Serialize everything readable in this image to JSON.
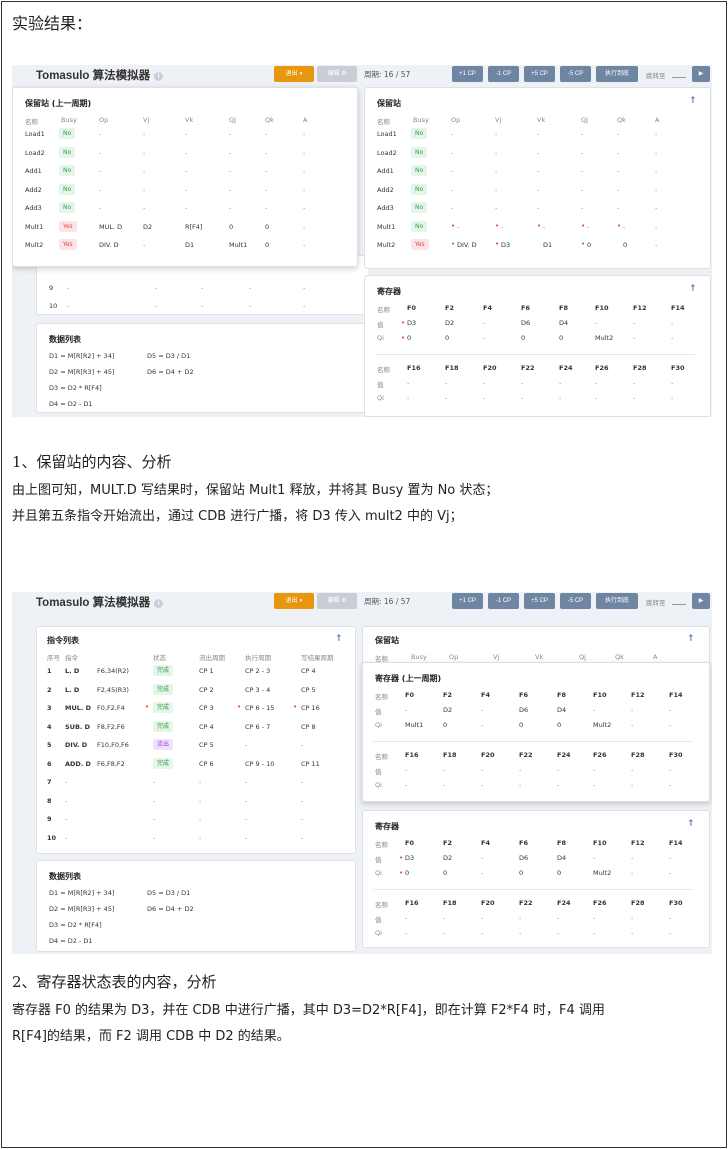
{
  "doc": {
    "heading": "实验结果：",
    "s1_title": "1、保留站的内容、分析",
    "s1_p1": "由上图可知，MULT.D 写结果时，保留站 Mult1 释放，并将其 Busy 置为 No 状态；",
    "s1_p2": "并且第五条指令开始流出，通过 CDB 进行广播，将 D3 传入 mult2 中的 Vj；",
    "s2_title": "2、寄存器状态表的内容，分析",
    "s2_p1": "寄存器 F0 的结果为 D3，并在 CDB 中进行广播，其中 D3=D2*R[F4]，即在计算 F2*F4 时，F4 调用",
    "s2_p2": "R[F4]的结果，而 F2 调用 CDB 中 D2 的结果。"
  },
  "sim": {
    "title": "Tomasulo 算法模拟器",
    "info_icon": "i",
    "btn_exit": "退出 ⏸",
    "btn_edit": "编辑 ⚙",
    "cycle": "周期: 16 / 57",
    "btn_p1": "+1 CP",
    "btn_m1": "-1 CP",
    "btn_p5": "+5 CP",
    "btn_m5": "-5 CP",
    "btn_run": "执行到底",
    "jump": "跳转至",
    "go": "▶"
  },
  "s1": {
    "rs_prev_title": "保留站 (上一周期)",
    "rs_title": "保留站",
    "rs_head": [
      "名称",
      "Busy",
      "Op",
      "Vj",
      "Vk",
      "Qj",
      "Qk",
      "A"
    ],
    "rs_prev": [
      [
        "Load1",
        "No",
        "-",
        "-",
        "-",
        "-",
        "-",
        "-"
      ],
      [
        "Load2",
        "No",
        "-",
        "-",
        "-",
        "-",
        "-",
        "-"
      ],
      [
        "Add1",
        "No",
        "-",
        "-",
        "-",
        "-",
        "-",
        "-"
      ],
      [
        "Add2",
        "No",
        "-",
        "-",
        "-",
        "-",
        "-",
        "-"
      ],
      [
        "Add3",
        "No",
        "-",
        "-",
        "-",
        "-",
        "-",
        "-"
      ],
      [
        "Mult1",
        "Yes",
        "MUL. D",
        "D2",
        "R[F4]",
        "0",
        "0",
        "-"
      ],
      [
        "Mult2",
        "Yes",
        "DIV. D",
        "-",
        "D1",
        "Mult1",
        "0",
        "-"
      ]
    ],
    "rs_cur": [
      [
        "Load1",
        "No",
        "-",
        "-",
        "-",
        "-",
        "-",
        "-"
      ],
      [
        "Load2",
        "No",
        "-",
        "-",
        "-",
        "-",
        "-",
        "-"
      ],
      [
        "Add1",
        "No",
        "-",
        "-",
        "-",
        "-",
        "-",
        "-"
      ],
      [
        "Add2",
        "No",
        "-",
        "-",
        "-",
        "-",
        "-",
        "-"
      ],
      [
        "Add3",
        "No",
        "-",
        "-",
        "-",
        "-",
        "-",
        "-"
      ],
      [
        "Mult1",
        "No",
        "-",
        "-",
        "-",
        "-",
        "-",
        "-"
      ],
      [
        "Mult2",
        "Yes",
        "DIV. D",
        "D3",
        "D1",
        "0",
        "0",
        "-"
      ]
    ],
    "instr_tail": [
      [
        "9",
        "-",
        "-",
        "-",
        "-",
        "-"
      ],
      [
        "10",
        "-",
        "-",
        "-",
        "-",
        "-"
      ]
    ],
    "reg_title": "寄存器",
    "reg_h1": [
      "名称",
      "F0",
      "F2",
      "F4",
      "F6",
      "F8",
      "F10",
      "F12",
      "F14"
    ],
    "reg_v1": [
      "值",
      "D3",
      "D2",
      "-",
      "D6",
      "D4",
      "-",
      "-",
      "-"
    ],
    "reg_q1": [
      "Qi",
      "0",
      "0",
      "-",
      "0",
      "0",
      "Mult2",
      "-",
      "-"
    ],
    "reg_h2": [
      "名称",
      "F16",
      "F18",
      "F20",
      "F22",
      "F24",
      "F26",
      "F28",
      "F30"
    ],
    "reg_v2": [
      "值",
      "-",
      "-",
      "-",
      "-",
      "-",
      "-",
      "-",
      "-"
    ],
    "reg_q2": [
      "Qi",
      "-",
      "-",
      "-",
      "-",
      "-",
      "-",
      "-",
      "-"
    ],
    "data_title": "数据列表",
    "data": [
      "D1 = M[R[R2] + 34]",
      "D5 = D3 / D1",
      "D2 = M[R[R3] + 45]",
      "D6 = D4 + D2",
      "D3 = D2 * R[F4]",
      "D4 = D2 - D1"
    ]
  },
  "s2": {
    "instr_title": "指令列表",
    "instr_head": [
      "序号",
      "指令",
      "状态",
      "流出周期",
      "执行周期",
      "写结果周期"
    ],
    "instr": [
      [
        "1",
        "L. D",
        "F6,34(R2)",
        "完成",
        "CP 1",
        "CP 2 - 3",
        "CP 4"
      ],
      [
        "2",
        "L. D",
        "F2,45(R3)",
        "完成",
        "CP 2",
        "CP 3 - 4",
        "CP 5"
      ],
      [
        "3",
        "MUL. D",
        "F0,F2,F4",
        "完成",
        "CP 3",
        "CP 6 - 15",
        "CP 16"
      ],
      [
        "4",
        "SUB. D",
        "F8,F2,F6",
        "完成",
        "CP 4",
        "CP 6 - 7",
        "CP 8"
      ],
      [
        "5",
        "DIV. D",
        "F10,F0,F6",
        "流出",
        "CP 5",
        "-",
        "-"
      ],
      [
        "6",
        "ADD. D",
        "F6,F8,F2",
        "完成",
        "CP 6",
        "CP 9 - 10",
        "CP 11"
      ],
      [
        "7",
        "-",
        "",
        "-",
        "-",
        "-",
        "-"
      ],
      [
        "8",
        "-",
        "",
        "-",
        "-",
        "-",
        "-"
      ],
      [
        "9",
        "-",
        "",
        "-",
        "-",
        "-",
        "-"
      ],
      [
        "10",
        "-",
        "",
        "-",
        "-",
        "-",
        "-"
      ]
    ],
    "rs_title": "保留站",
    "rs_head": [
      "名称",
      "Busy",
      "Op",
      "Vj",
      "Vk",
      "Qj",
      "Qk",
      "A"
    ],
    "reg_prev_title": "寄存器 (上一周期)",
    "reg_prev_h1": [
      "名称",
      "F0",
      "F2",
      "F4",
      "F6",
      "F8",
      "F10",
      "F12",
      "F14"
    ],
    "reg_prev_v1": [
      "值",
      "-",
      "D2",
      "-",
      "D6",
      "D4",
      "-",
      "-",
      "-"
    ],
    "reg_prev_q1": [
      "Qi",
      "Mult1",
      "0",
      "-",
      "0",
      "0",
      "Mult2",
      "-",
      "-"
    ],
    "reg_prev_h2": [
      "名称",
      "F16",
      "F18",
      "F20",
      "F22",
      "F24",
      "F26",
      "F28",
      "F30"
    ],
    "reg_prev_v2": [
      "值",
      "-",
      "-",
      "-",
      "-",
      "-",
      "-",
      "-",
      "-"
    ],
    "reg_prev_q2": [
      "Qi",
      "-",
      "-",
      "-",
      "-",
      "-",
      "-",
      "-",
      "-"
    ],
    "reg_title": "寄存器",
    "reg_h1": [
      "名称",
      "F0",
      "F2",
      "F4",
      "F6",
      "F8",
      "F10",
      "F12",
      "F14"
    ],
    "reg_v1": [
      "值",
      "D3",
      "D2",
      "-",
      "D6",
      "D4",
      "-",
      "-",
      "-"
    ],
    "reg_q1": [
      "Qi",
      "0",
      "0",
      "-",
      "0",
      "0",
      "Mult2",
      "-",
      "-"
    ],
    "reg_h2": [
      "名称",
      "F16",
      "F18",
      "F20",
      "F22",
      "F24",
      "F26",
      "F28",
      "F30"
    ],
    "reg_v2": [
      "值",
      "-",
      "-",
      "-",
      "-",
      "-",
      "-",
      "-",
      "-"
    ],
    "reg_q2": [
      "Qi",
      "-",
      "-",
      "-",
      "-",
      "-",
      "-",
      "-",
      "-"
    ],
    "data_title": "数据列表",
    "data": [
      "D1 = M[R[R2] + 34]",
      "D5 = D3 / D1",
      "D2 = M[R[R3] + 45]",
      "D6 = D4 + D2",
      "D3 = D2 * R[F4]",
      "D4 = D2 - D1"
    ]
  }
}
